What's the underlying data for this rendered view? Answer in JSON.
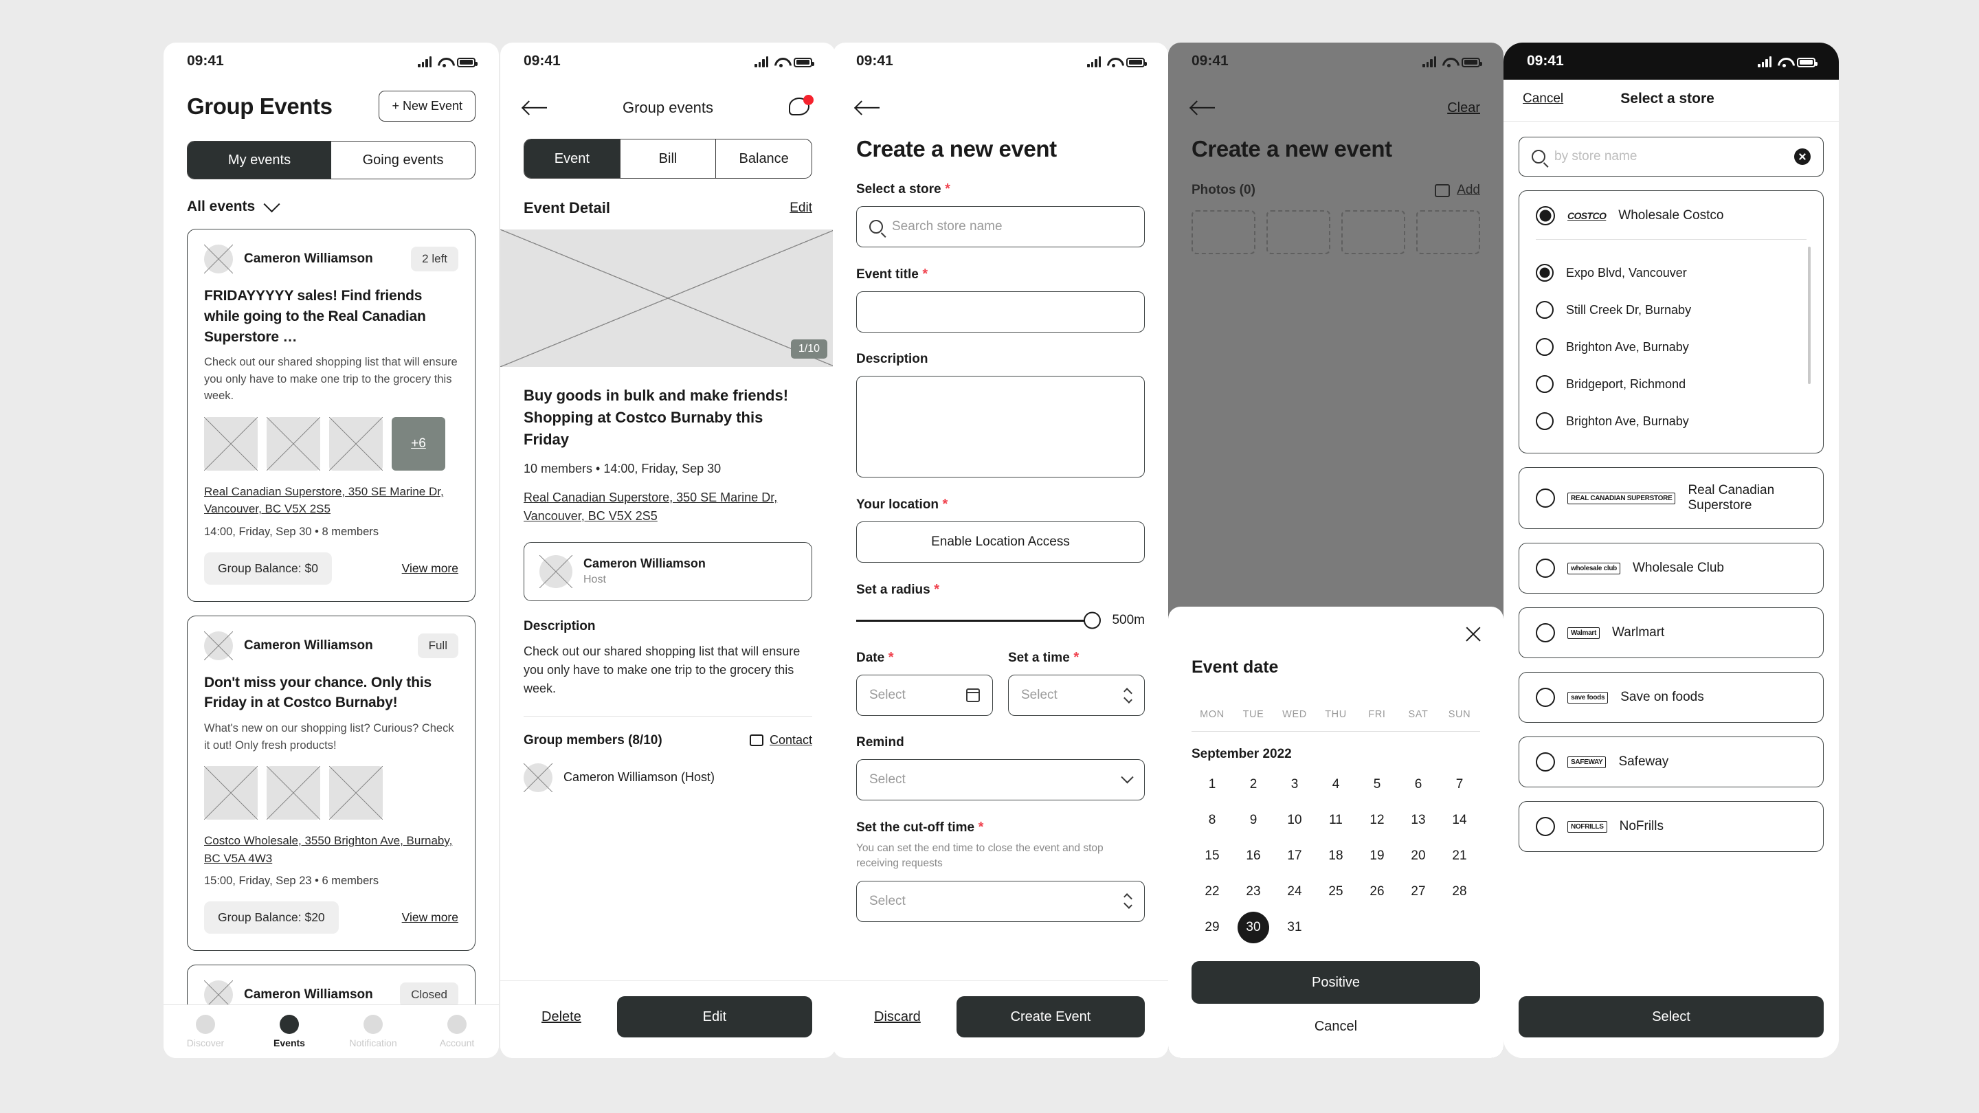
{
  "status_bar": {
    "time": "09:41"
  },
  "colors": {
    "dark": "#2c3131",
    "accent_red": "#f5222d",
    "required": "#f0434f",
    "muted": "#8a8a8a"
  },
  "screen1": {
    "title": "Group Events",
    "new_event_button": "+ New Event",
    "tabs": [
      {
        "label": "My events",
        "active": true
      },
      {
        "label": "Going events",
        "active": false
      }
    ],
    "filter": "All events",
    "cards": [
      {
        "author": "Cameron Williamson",
        "badge": "2 left",
        "title": "FRIDAYYYYY sales! Find friends while going to the Real Canadian Superstore …",
        "desc": "Check out our shared shopping list that will ensure you only have to make one trip to the grocery this week.",
        "more_photos": "+6",
        "address": "Real Canadian Superstore, 350 SE Marine Dr, Vancouver, BC V5X 2S5",
        "meta": "14:00, Friday, Sep 30 • 8 members",
        "balance": "Group Balance: $0",
        "view_more": "View more"
      },
      {
        "author": "Cameron Williamson",
        "badge": "Full",
        "title": "Don't miss your chance. Only this Friday in at Costco Burnaby!",
        "desc": "What's new on our shopping list? Curious? Check it out! Only fresh products!",
        "address": "Costco Wholesale, 3550 Brighton Ave, Burnaby, BC V5A 4W3",
        "meta": "15:00, Friday, Sep 23 • 6 members",
        "balance": "Group Balance: $20",
        "view_more": "View more"
      },
      {
        "author": "Cameron Williamson",
        "badge": "Closed"
      }
    ],
    "tabbar": [
      {
        "label": "Discover",
        "active": false
      },
      {
        "label": "Events",
        "active": true
      },
      {
        "label": "Notification",
        "active": false
      },
      {
        "label": "Account",
        "active": false
      }
    ]
  },
  "screen2": {
    "nav_title": "Group events",
    "tabs": [
      {
        "label": "Event",
        "active": true
      },
      {
        "label": "Bill",
        "active": false
      },
      {
        "label": "Balance",
        "active": false
      }
    ],
    "section_title": "Event Detail",
    "edit_link": "Edit",
    "photo_count": "1/10",
    "event_title": "Buy goods in bulk and make friends! Shopping at Costco Burnaby this Friday",
    "event_meta": "10 members • 14:00, Friday, Sep 30",
    "event_address": "Real Canadian Superstore, 350 SE Marine Dr, Vancouver, BC V5X 2S5",
    "host_name": "Cameron Williamson",
    "host_role": "Host",
    "description_label": "Description",
    "description_text": "Check out our shared shopping list that will ensure you only have to make one trip to the grocery this week.",
    "members_label": "Group members (8/10)",
    "contact_label": "Contact",
    "member_1": "Cameron Williamson (Host)",
    "delete_button": "Delete",
    "edit_button": "Edit"
  },
  "screen3": {
    "page_title": "Create a new event",
    "store_label": "Select a store",
    "store_placeholder": "Search store name",
    "title_label": "Event title",
    "title_value": "",
    "description_label": "Description",
    "description_value": "",
    "location_label": "Your location",
    "location_button": "Enable Location Access",
    "radius_label": "Set a radius",
    "radius_value": "500m",
    "date_label": "Date",
    "date_placeholder": "Select",
    "time_label": "Set a time",
    "time_placeholder": "Select",
    "remind_label": "Remind",
    "remind_placeholder": "Select",
    "cutoff_label": "Set the cut-off time",
    "cutoff_hint": "You can set the end time to close the event and stop receiving requests",
    "cutoff_placeholder": "Select",
    "discard_button": "Discard",
    "create_button": "Create Event"
  },
  "screen4": {
    "clear_link": "Clear",
    "page_title": "Create a new event",
    "photos_label": "Photos",
    "photos_count": "(0)",
    "add_link": "Add",
    "sheet_title": "Event date",
    "weekdays": [
      "MON",
      "TUE",
      "WED",
      "THU",
      "FRI",
      "SAT",
      "SUN"
    ],
    "month": "September 2022",
    "days": [
      1,
      2,
      3,
      4,
      5,
      6,
      7,
      8,
      9,
      10,
      11,
      12,
      13,
      14,
      15,
      16,
      17,
      18,
      19,
      20,
      21,
      22,
      23,
      24,
      25,
      26,
      27,
      28,
      29,
      30,
      31
    ],
    "selected_day": 30,
    "confirm_button": "Positive",
    "cancel_button": "Cancel"
  },
  "screen5": {
    "cancel_label": "Cancel",
    "title": "Select a store",
    "search_placeholder": "by store name",
    "stores": [
      {
        "logo": "COSTCO",
        "logo_sub": "WHOLESALE",
        "name": "Wholesale Costco",
        "selected": true,
        "branches": [
          {
            "label": "Expo Blvd, Vancouver",
            "selected": true
          },
          {
            "label": "Still Creek Dr, Burnaby",
            "selected": false
          },
          {
            "label": "Brighton Ave, Burnaby",
            "selected": false
          },
          {
            "label": "Bridgeport, Richmond",
            "selected": false
          },
          {
            "label": "Brighton Ave, Burnaby",
            "selected": false
          }
        ]
      },
      {
        "logo": "REAL CANADIAN",
        "logo_sub": "SUPERSTORE",
        "name": "Real Canadian Superstore",
        "selected": false,
        "branches": []
      },
      {
        "logo": "wholesale",
        "logo_sub": "club",
        "name": "Wholesale Club",
        "selected": false,
        "branches": []
      },
      {
        "logo": "Walmart",
        "logo_sub": "",
        "name": "Warlmart",
        "selected": false,
        "branches": []
      },
      {
        "logo": "save",
        "logo_sub": "foods",
        "name": "Save on foods",
        "selected": false,
        "branches": []
      },
      {
        "logo": "SAFEWAY",
        "logo_sub": "",
        "name": "Safeway",
        "selected": false,
        "branches": []
      },
      {
        "logo": "NOFRILLS",
        "logo_sub": "",
        "name": "NoFrills",
        "selected": false,
        "branches": []
      }
    ],
    "select_button": "Select"
  }
}
